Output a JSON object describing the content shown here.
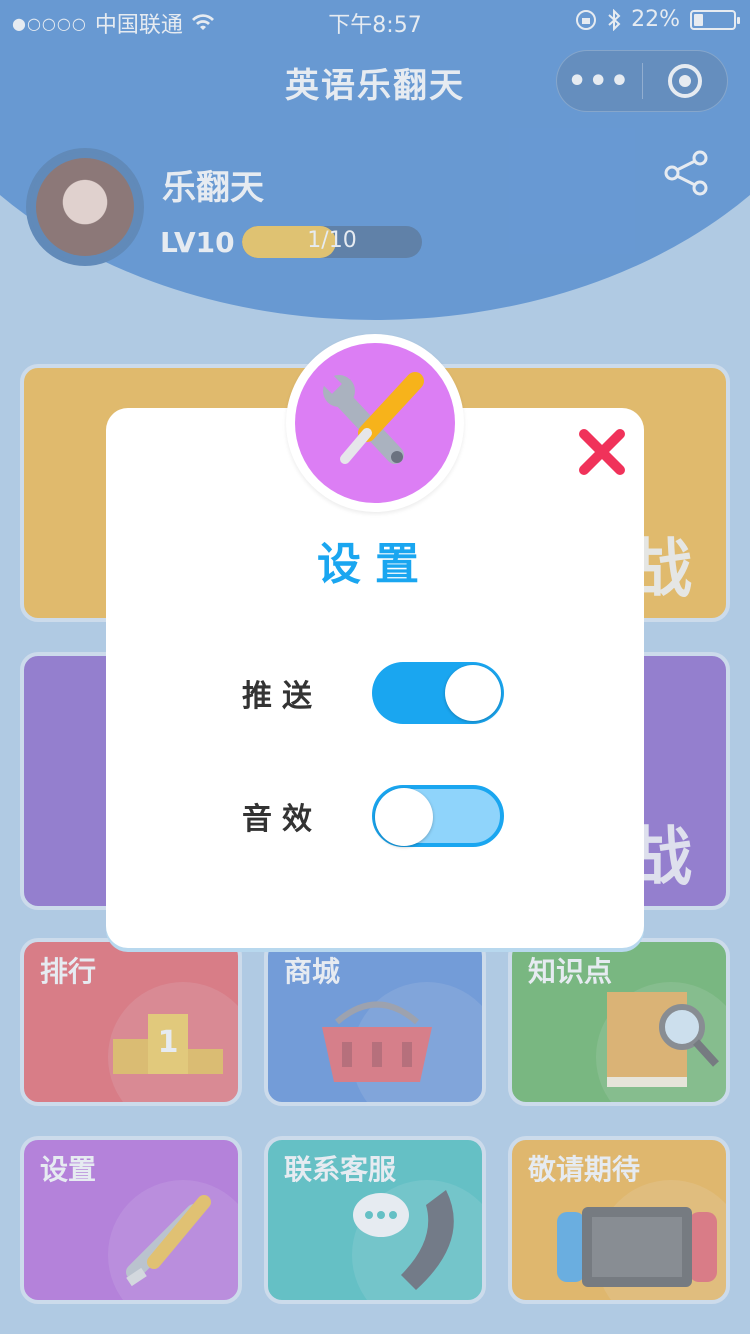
{
  "status_bar": {
    "signal": "●○○○○",
    "carrier": "中国联通",
    "time": "下午8:57",
    "battery": "22%"
  },
  "nav": {
    "title": "英语乐翻天",
    "more_label": "•••"
  },
  "profile": {
    "name": "乐翻天",
    "level": "LV10",
    "xp_text": "1/10",
    "xp_fraction": 0.1
  },
  "cards": {
    "big1_char": "战",
    "big2_char": "战"
  },
  "tiles": [
    {
      "label": "排行",
      "color": "#e5373f"
    },
    {
      "label": "商城",
      "color": "#2f6fd1"
    },
    {
      "label": "知识点",
      "color": "#3aa133"
    },
    {
      "label": "设置",
      "color": "#a440d6"
    },
    {
      "label": "联系客服",
      "color": "#14b1b0"
    },
    {
      "label": "敬请期待",
      "color": "#f3a112"
    }
  ],
  "modal": {
    "title": "设置",
    "icon": "wrench-screwdriver-icon",
    "rows": [
      {
        "label": "推送",
        "on": true
      },
      {
        "label": "音效",
        "on": false
      }
    ]
  },
  "colors": {
    "accent": "#1aa6f0",
    "close": "#f0325a",
    "header": "#1a6bc7",
    "badge": "#dc7ef4"
  }
}
